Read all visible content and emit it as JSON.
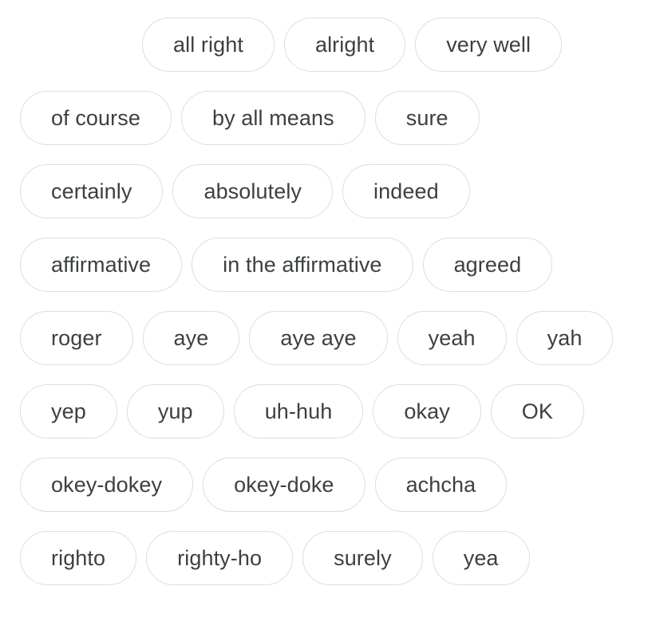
{
  "page": {
    "type": "synonym-chip-cloud",
    "background_color": "#ffffff",
    "chip_border_color": "#dcdddf",
    "chip_text_color": "#3c4043",
    "chip_fill_color": "#ffffff"
  },
  "chip_rows": [
    {
      "row_index": 0,
      "indented": true,
      "chips": [
        {
          "label": "all right"
        },
        {
          "label": "alright"
        },
        {
          "label": "very well"
        }
      ]
    },
    {
      "row_index": 1,
      "indented": false,
      "chips": [
        {
          "label": "of course"
        },
        {
          "label": "by all means"
        },
        {
          "label": "sure"
        }
      ]
    },
    {
      "row_index": 2,
      "indented": false,
      "chips": [
        {
          "label": "certainly"
        },
        {
          "label": "absolutely"
        },
        {
          "label": "indeed"
        }
      ]
    },
    {
      "row_index": 3,
      "indented": false,
      "chips": [
        {
          "label": "affirmative"
        },
        {
          "label": "in the affirmative"
        },
        {
          "label": "agreed"
        }
      ]
    },
    {
      "row_index": 4,
      "indented": false,
      "chips": [
        {
          "label": "roger"
        },
        {
          "label": "aye"
        },
        {
          "label": "aye aye"
        },
        {
          "label": "yeah"
        },
        {
          "label": "yah"
        }
      ]
    },
    {
      "row_index": 5,
      "indented": false,
      "chips": [
        {
          "label": "yep"
        },
        {
          "label": "yup"
        },
        {
          "label": "uh-huh"
        },
        {
          "label": "okay"
        },
        {
          "label": "OK"
        }
      ]
    },
    {
      "row_index": 6,
      "indented": false,
      "chips": [
        {
          "label": "okey-dokey"
        },
        {
          "label": "okey-doke"
        },
        {
          "label": "achcha"
        }
      ]
    },
    {
      "row_index": 7,
      "indented": false,
      "chips": [
        {
          "label": "righto"
        },
        {
          "label": "righty-ho"
        },
        {
          "label": "surely"
        },
        {
          "label": "yea"
        }
      ]
    }
  ]
}
